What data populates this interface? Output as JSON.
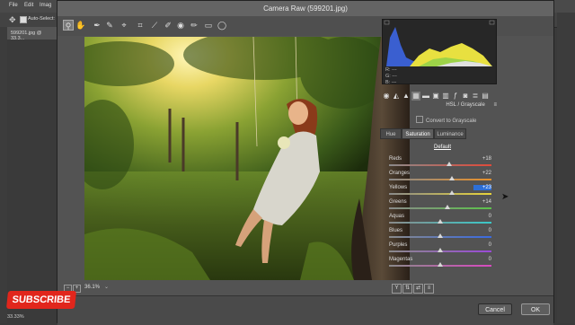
{
  "ps": {
    "menu": [
      "File",
      "Edit",
      "Imag"
    ],
    "options_label": "Auto-Select:",
    "doc_tab": "599201.jpg @ 33.3...",
    "status_zoom": "33.33%"
  },
  "dialog": {
    "title": "Camera Raw (599201.jpg)",
    "zoom_level": "36.1%",
    "cancel_label": "Cancel",
    "ok_label": "OK"
  },
  "histogram": {
    "r_label": "R:",
    "r_value": "---",
    "g_label": "G:",
    "g_value": "---",
    "b_label": "B:",
    "b_value": "---"
  },
  "panel": {
    "title": "HSL / Grayscale",
    "convert_label": "Convert to Grayscale",
    "tabs": [
      {
        "label": "Hue"
      },
      {
        "label": "Saturation"
      },
      {
        "label": "Luminance"
      }
    ],
    "default_label": "Default",
    "sliders": [
      {
        "label": "Reds",
        "value": "+18",
        "level": 18
      },
      {
        "label": "Oranges",
        "value": "+22",
        "level": 22
      },
      {
        "label": "Yellows",
        "value": "+23",
        "level": 23
      },
      {
        "label": "Greens",
        "value": "+14",
        "level": 14
      },
      {
        "label": "Aquas",
        "value": "0",
        "level": 0
      },
      {
        "label": "Blues",
        "value": "0",
        "level": 0
      },
      {
        "label": "Purples",
        "value": "0",
        "level": 0
      },
      {
        "label": "Magentas",
        "value": "0",
        "level": 0
      }
    ],
    "slider_colors": [
      "#e04a3a",
      "#e8902a",
      "#e8d43a",
      "#5cc24a",
      "#3ac8c8",
      "#3a6ae0",
      "#9a4ad8",
      "#d84ac0"
    ]
  },
  "badge": {
    "subscribe_label": "SUBSCRIBE"
  },
  "icons": {
    "toolbar": [
      "zoom-icon",
      "hand-icon",
      "white-balance-icon",
      "color-sampler-icon",
      "target-adjust-icon",
      "crop-icon",
      "straighten-icon",
      "spot-removal-icon",
      "red-eye-icon",
      "adjustment-brush-icon",
      "graduated-filter-icon",
      "radial-filter-icon"
    ]
  }
}
